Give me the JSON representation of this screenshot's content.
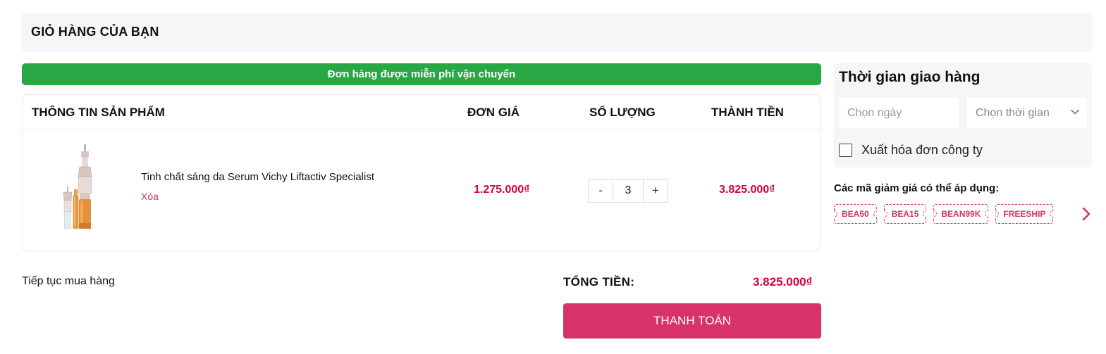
{
  "header": {
    "title": "GIỎ HÀNG CỦA BẠN"
  },
  "banner": {
    "free_shipping": "Đơn hàng được miễn phí vận chuyển"
  },
  "table": {
    "columns": [
      "THÔNG TIN SẢN PHẨM",
      "ĐƠN GIÁ",
      "SỐ LƯỢNG",
      "THÀNH TIỀN"
    ],
    "items": [
      {
        "name": "Tinh chất sáng da Serum Vichy Liftactiv Specialist",
        "remove_label": "Xóa",
        "unit_price": "1.275.000₫",
        "qty_minus": "-",
        "quantity": "3",
        "qty_plus": "+",
        "line_total": "3.825.000₫"
      }
    ]
  },
  "footer": {
    "continue_label": "Tiếp tục mua hàng",
    "total_label": "TỔNG TIỀN:",
    "total_value": "3.825.000₫",
    "checkout_label": "THANH TOÁN"
  },
  "delivery": {
    "title": "Thời gian giao hàng",
    "date_placeholder": "Chọn ngày",
    "time_placeholder": "Chọn thời gian",
    "invoice_label": "Xuất hóa đơn công ty",
    "invoice_checked": false
  },
  "coupons": {
    "title": "Các mã giảm giá có thể áp dụng:",
    "codes": [
      "BEA50",
      "BEA15",
      "BEAN99K",
      "FREESHIP"
    ]
  },
  "colors": {
    "accent_pink": "#d7336a",
    "price_red": "#d6003f",
    "success_green": "#28a745"
  }
}
